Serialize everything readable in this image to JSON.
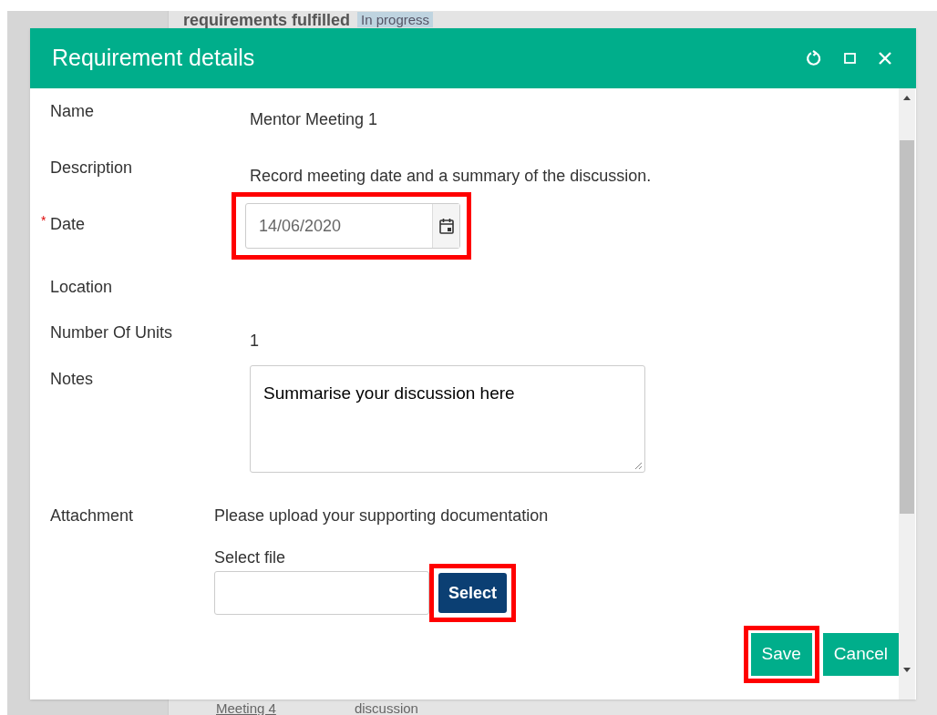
{
  "background": {
    "heading": "requirements fulfilled",
    "status_badge": "In progress",
    "link": "Meeting 4",
    "cell_text": "discussion"
  },
  "dialog": {
    "title": "Requirement details",
    "fields": [
      {
        "kind": "text",
        "label": "Name",
        "value": "Mentor Meeting 1"
      },
      {
        "kind": "text",
        "label": "Description",
        "value": "Record meeting date and a summary of the discussion."
      },
      {
        "kind": "date",
        "label": "Date",
        "required_mark": "*",
        "value": "14/06/2020",
        "highlighted": true
      },
      {
        "kind": "text",
        "label": "Location"
      },
      {
        "kind": "text",
        "label": "Number Of Units",
        "value": "1"
      },
      {
        "kind": "textarea",
        "label": "Notes",
        "value": "Summarise your discussion here"
      },
      {
        "kind": "file",
        "label": "Attachment",
        "hint": "Please upload your supporting documentation",
        "file_label": "Select file",
        "button": "Select",
        "highlighted": true
      }
    ],
    "buttons": [
      {
        "label": "Save",
        "highlighted": true
      },
      {
        "label": "Cancel",
        "highlighted": false
      }
    ]
  }
}
